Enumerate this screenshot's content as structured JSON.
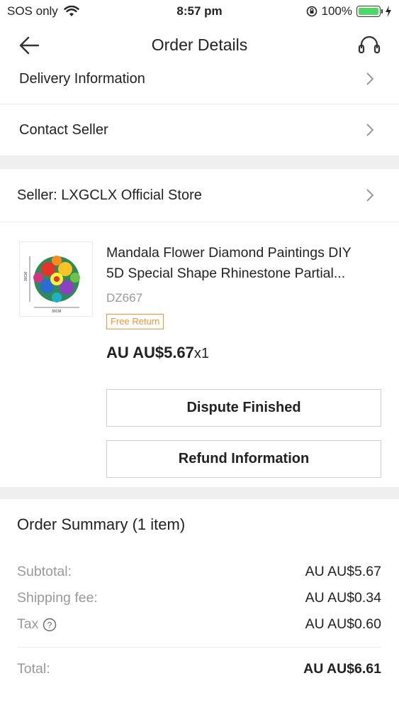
{
  "status": {
    "carrier": "SOS only",
    "time": "8:57 pm",
    "battery": "100%",
    "battery_level": 1.0
  },
  "nav": {
    "title": "Order Details"
  },
  "links": {
    "delivery": "Delivery Information",
    "contact": "Contact Seller"
  },
  "seller": {
    "label": "Seller: LXGCLX Official Store"
  },
  "product": {
    "title_line1": "Mandala Flower Diamond Paintings DIY",
    "title_line2": "5D Special Shape Rhinestone Partial...",
    "sku": "DZ667",
    "badge": "Free Return",
    "price": "AU AU$5.67",
    "qty": "x1",
    "image_dim_side": "30CM",
    "image_dim_bottom": "30CM"
  },
  "actions": {
    "dispute": "Dispute Finished",
    "refund": "Refund Information"
  },
  "summary": {
    "title": "Order Summary (1 item)",
    "subtotal_label": "Subtotal:",
    "subtotal_value": "AU AU$5.67",
    "shipping_label": "Shipping fee:",
    "shipping_value": "AU AU$0.34",
    "tax_label": "Tax",
    "tax_value": "AU AU$0.60",
    "total_label": "Total:",
    "total_value": "AU AU$6.61"
  },
  "colors": {
    "accent_red": "#e8402f",
    "badge_orange": "#f0943d",
    "battery_green": "#4cd964"
  }
}
